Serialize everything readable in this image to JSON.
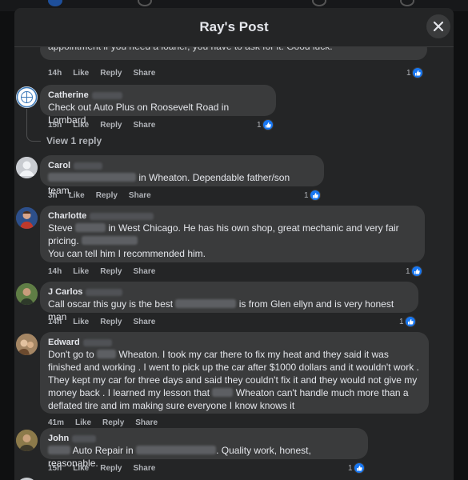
{
  "modal": {
    "title": "Ray's Post",
    "view_replies": "View 1 reply"
  },
  "colors": {
    "bg": "#242526",
    "bubble": "#3a3b3c",
    "text": "#e4e6eb",
    "muted": "#b0b3b8",
    "like": "#1877f2"
  },
  "actions": {
    "like": "Like",
    "reply": "Reply",
    "share": "Share"
  },
  "comments": [
    {
      "author": "",
      "text": "appointment if you need a loaner, you have to ask for it. Good luck.",
      "time": "14h",
      "reactions": "1"
    },
    {
      "author": "Catherine",
      "text": "Check out Auto Plus on Roosevelt Road in Lombard.",
      "time": "15h",
      "reactions": "1"
    },
    {
      "author": "Carol",
      "text": "in Wheaton. Dependable father/son team.",
      "time": "3h",
      "reactions": "1"
    },
    {
      "author": "Charlotte",
      "line1a": "Steve",
      "line1b": "in West Chicago. He has his own shop, great mechanic and very fair",
      "line2": "pricing.",
      "line3": "You can tell him I recommended him.",
      "time": "14h",
      "reactions": "1"
    },
    {
      "author": "J Carlos",
      "text_a": "Call oscar this guy is the best",
      "text_b": "is from Glen ellyn and is very honest man",
      "time": "14h",
      "reactions": "1"
    },
    {
      "author": "Edward",
      "line1a": "Don't go to",
      "line1b": "Wheaton. I took my car there to fix my heat and they said it was",
      "line2": "finished and working . I went to pick up the car after $1000 dollars and it wouldn't work .",
      "line3": "They kept my car for three days and said they couldn't fix it and they would not give my",
      "line4": "money back . I learned my lesson that",
      "line4b": "Wheaton can't handle much more than a",
      "line5": "deflated tire and im making sure everyone I know knows it",
      "time": "41m"
    },
    {
      "author": "John",
      "text_a": "Auto Repair in",
      "text_b": ". Quality work, honest, reasonable.",
      "time": "15h",
      "reactions": "1"
    }
  ]
}
